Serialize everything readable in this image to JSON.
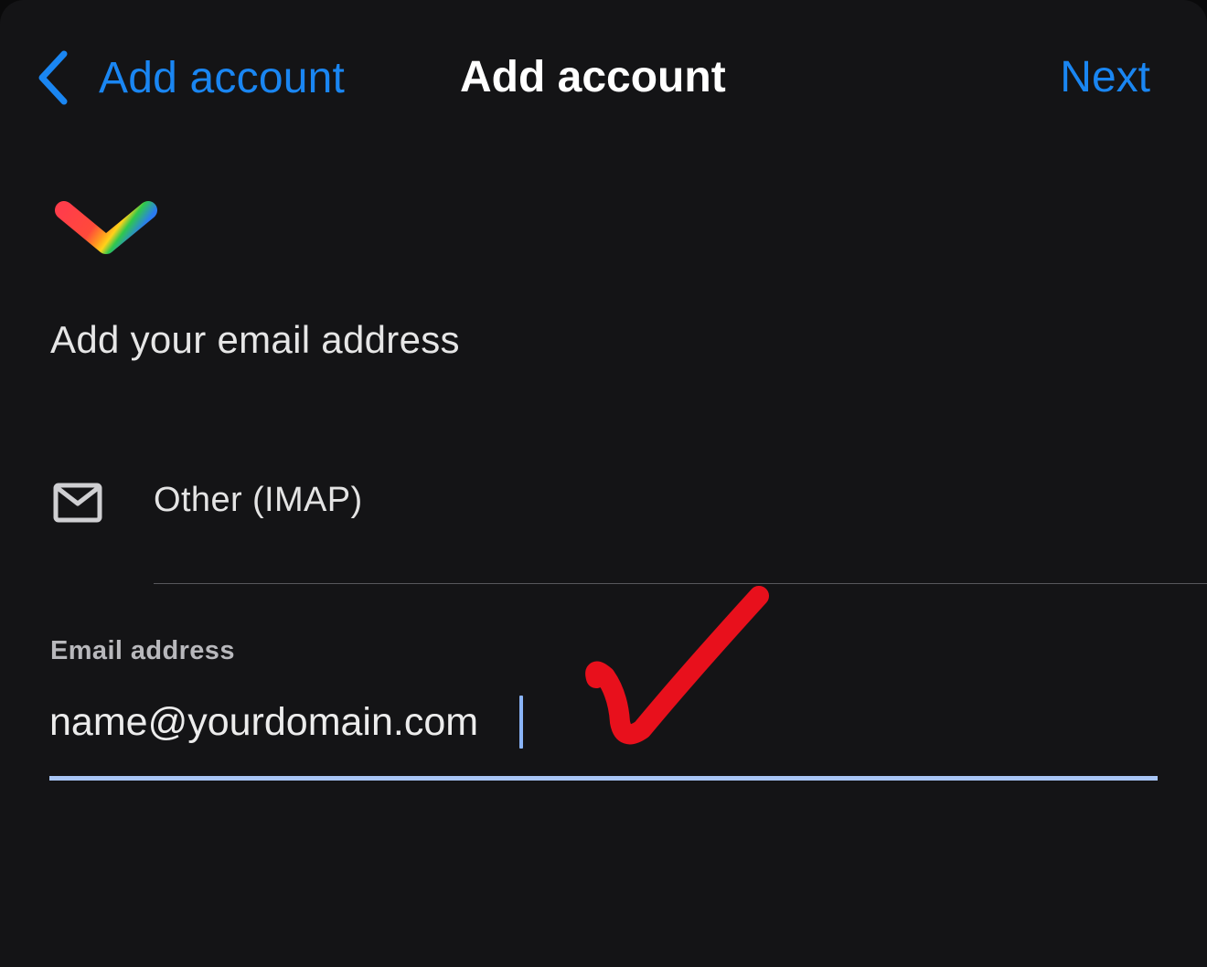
{
  "nav": {
    "back_label": "Add account",
    "title": "Add account",
    "next_label": "Next",
    "accent_color": "#1a86f2"
  },
  "logo": {
    "icon": "gmail-m-logo"
  },
  "heading": "Add your email address",
  "provider": {
    "icon": "envelope-icon",
    "label": "Other (IMAP)"
  },
  "email_field": {
    "label": "Email address",
    "value": "name@yourdomain.com",
    "focus_color": "#a8c5f5"
  },
  "annotation": {
    "icon": "red-checkmark",
    "color": "#e8101c"
  }
}
